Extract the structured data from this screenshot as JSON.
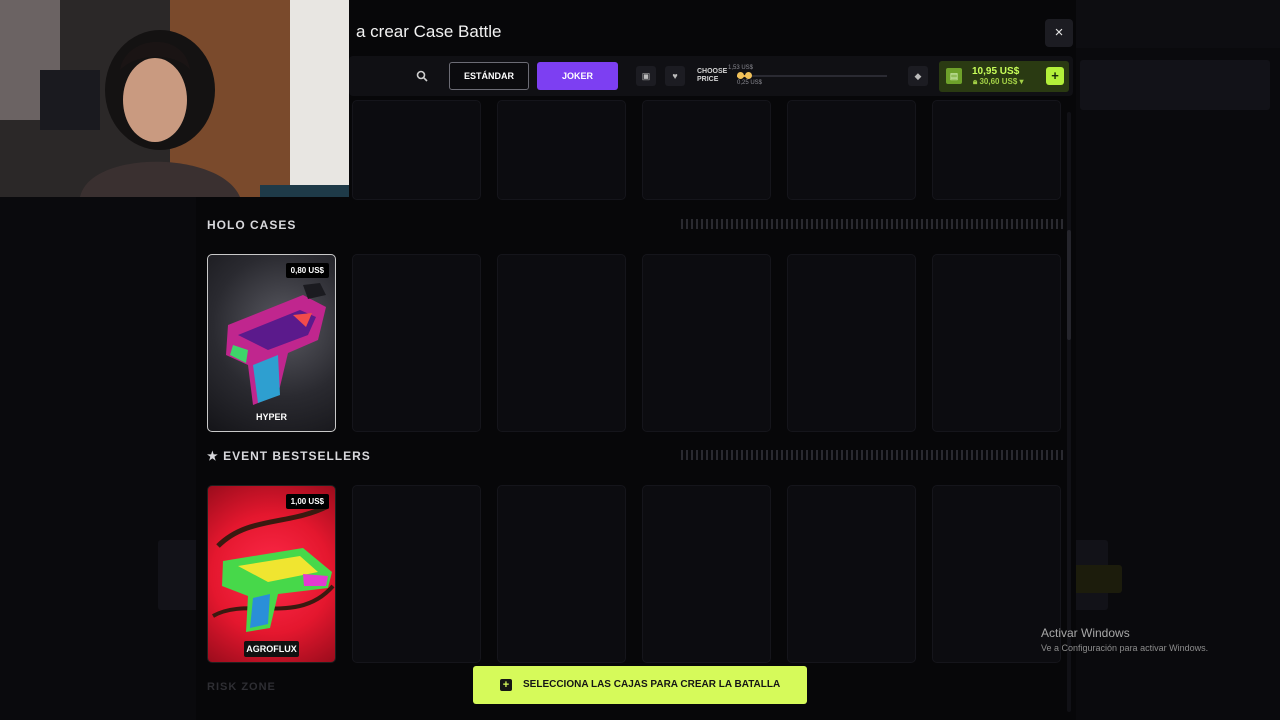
{
  "modal": {
    "title": "a crear Case Battle",
    "close_label": "×"
  },
  "toolbar": {
    "standard_label": "ESTÁNDAR",
    "joker_label": "JOKER",
    "choose_price": "CHOOSE PRICE",
    "price_max": "1,53 US$",
    "price_min": "0,25 US$",
    "balance_main": "10,95 US$",
    "balance_sub": "30,60 US$",
    "add_label": "+"
  },
  "sections": [
    {
      "title": "HOLO CASES",
      "cases": [
        {
          "name": "HYPER",
          "price": "0,80 US$"
        }
      ]
    },
    {
      "title": "★ EVENT BESTSELLERS",
      "cases": [
        {
          "name": "AGROFLUX",
          "price": "1,00 US$"
        }
      ]
    },
    {
      "title": "RISK ZONE",
      "cases": []
    }
  ],
  "cta": {
    "label": "SELECCIONA LAS CAJAS PARA CREAR LA BATALLA"
  },
  "watermark": {
    "title": "Activar Windows",
    "subtitle": "Ve a Configuración para activar Windows."
  },
  "colors": {
    "accent_purple": "#7d3ff2",
    "accent_lime": "#d6fa5a",
    "balance_green": "#c8ff5a"
  }
}
